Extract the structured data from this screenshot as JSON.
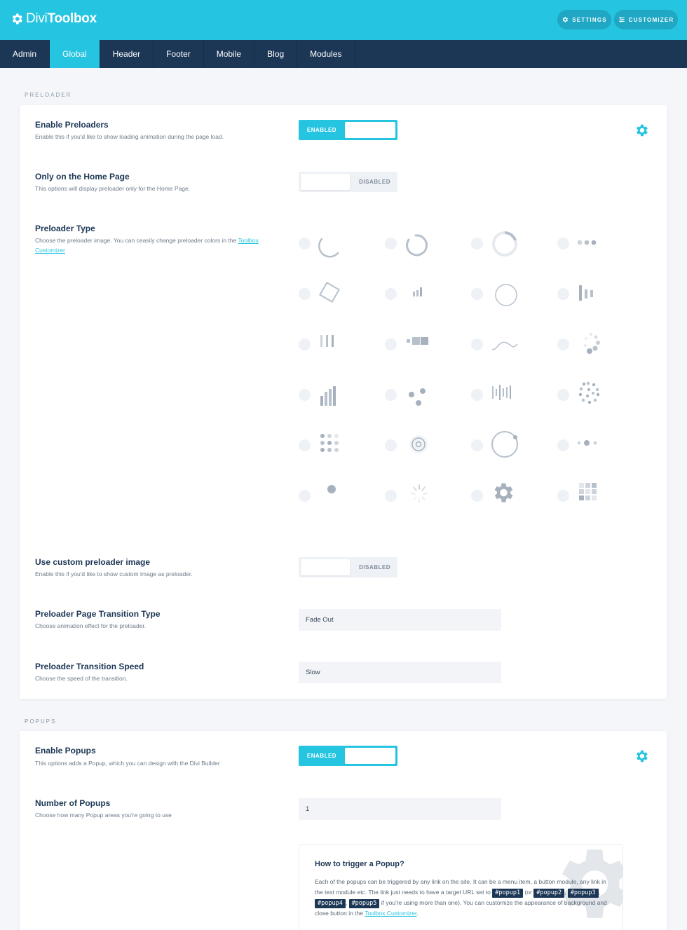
{
  "app": {
    "logo_light": "Divi",
    "logo_bold": "Toolbox"
  },
  "top_buttons": {
    "settings": "SETTINGS",
    "customizer": "CUSTOMIZER"
  },
  "nav": {
    "tabs": [
      "Admin",
      "Global",
      "Header",
      "Footer",
      "Mobile",
      "Blog",
      "Modules"
    ],
    "active": "Global"
  },
  "preloader": {
    "section_label": "PRELOADER",
    "enable": {
      "title": "Enable Preloaders",
      "desc": "Enable this if you'd like to show loading animation during the page load.",
      "state": "ENABLED"
    },
    "home_only": {
      "title": "Only on the Home Page",
      "desc": "This options will display preloader only for the Home Page.",
      "state": "DISABLED"
    },
    "type": {
      "title": "Preloader Type",
      "desc": "Choose the preloader image. You can ceasily change preloader colors in the",
      "link": "Toolbox Customizer"
    },
    "custom_image": {
      "title": "Use custom preloader image",
      "desc": "Enable this if you'd like to show custom image as preloader.",
      "state": "DISABLED"
    },
    "transition_type": {
      "title": "Preloader Page Transition Type",
      "desc": "Choose animation effect for the preloader.",
      "value": "Fade Out"
    },
    "transition_speed": {
      "title": "Preloader Transition Speed",
      "desc": "Choose the speed of the transition.",
      "value": "Slow"
    }
  },
  "popups": {
    "section_label": "POPUPS",
    "enable": {
      "title": "Enable Popups",
      "desc": "This options adds a Popup, which you can design with the Divi Builder",
      "state": "ENABLED"
    },
    "count": {
      "title": "Number of Popups",
      "desc": "Choose how many Popup areas you're going to use",
      "value": "1"
    },
    "info": {
      "title": "How to trigger a Popup?",
      "text_1": "Each of the popups can be triggered by any link on the site. It can be a menu item, a button module, any link in the text module etc. The link just needs to have a target URL set to",
      "code_1": "#popup1",
      "text_2": "(or",
      "code_2": "#popup2",
      "code_3": "#popup3",
      "code_4": "#popup4",
      "code_5": "#popup5",
      "text_3": "if you're using more than one). You can customize the appearance of background and close button in the",
      "link": "Toolbox Customizer",
      "text_4": "."
    }
  },
  "colors": {
    "accent": "#25c4e0",
    "nav_bg": "#1c3655",
    "icon_gray": "#b7c1cc"
  }
}
